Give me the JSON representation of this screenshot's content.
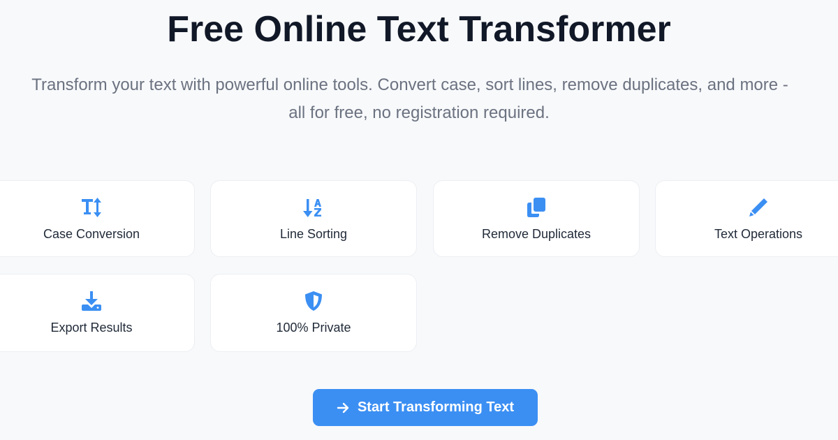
{
  "hero": {
    "title": "Free Online Text Transformer",
    "subtitle_line1": "Transform your text with powerful online tools. Convert case, sort lines, remove duplicates, and more -",
    "subtitle_line2": "all for free, no registration required."
  },
  "features": [
    {
      "label": "Case Conversion",
      "icon": "text-height-icon"
    },
    {
      "label": "Line Sorting",
      "icon": "sort-alpha-down-icon"
    },
    {
      "label": "Remove Duplicates",
      "icon": "copy-icon"
    },
    {
      "label": "Text Operations",
      "icon": "pen-icon"
    },
    {
      "label": "Export Results",
      "icon": "download-icon"
    },
    {
      "label": "100% Private",
      "icon": "shield-icon"
    }
  ],
  "cta": {
    "label": "Start Transforming Text",
    "icon": "arrow-right-icon"
  },
  "colors": {
    "background": "#f8f9fb",
    "accent": "#3b8ff3",
    "title": "#111827",
    "subtitle": "#6b7280"
  }
}
